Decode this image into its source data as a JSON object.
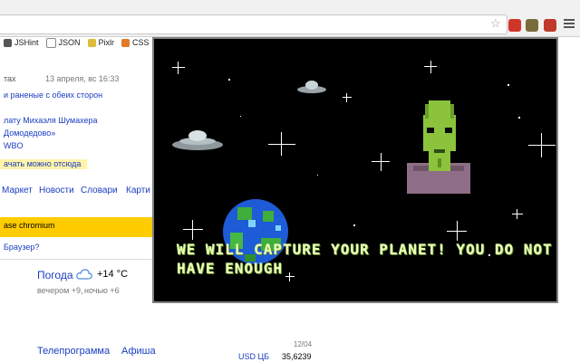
{
  "browser": {
    "bookmarks": [
      "JSHint",
      "JSON",
      "Pixlr",
      "CSS"
    ]
  },
  "page": {
    "header_frag": "тах",
    "date": "13 апреля, вс 16:33",
    "news1": "и раненые с обеих сторон",
    "news2": "лату Михаэля Шумахера",
    "news3": "Домодедово»",
    "news4": "WBO",
    "news5": "ачать можно отсюда",
    "nav": [
      "Маркет",
      "Новости",
      "Словари",
      "Карти"
    ],
    "banner": "ase chromium",
    "browser_q": "Браузер?",
    "weather_title": "Погода",
    "weather_temp": "+14 °C",
    "weather_eve": "вечером +9,",
    "weather_night": "ночью +6",
    "tv": "Телепрограмма",
    "afisha": "Афиша",
    "date2": "12/04",
    "usd_label": "USD ЦБ",
    "usd_val": "35,6239"
  },
  "game": {
    "message": "WE WILL CAPTURE YOUR PLANET! YOU DO NOT HAVE ENOUGH"
  }
}
